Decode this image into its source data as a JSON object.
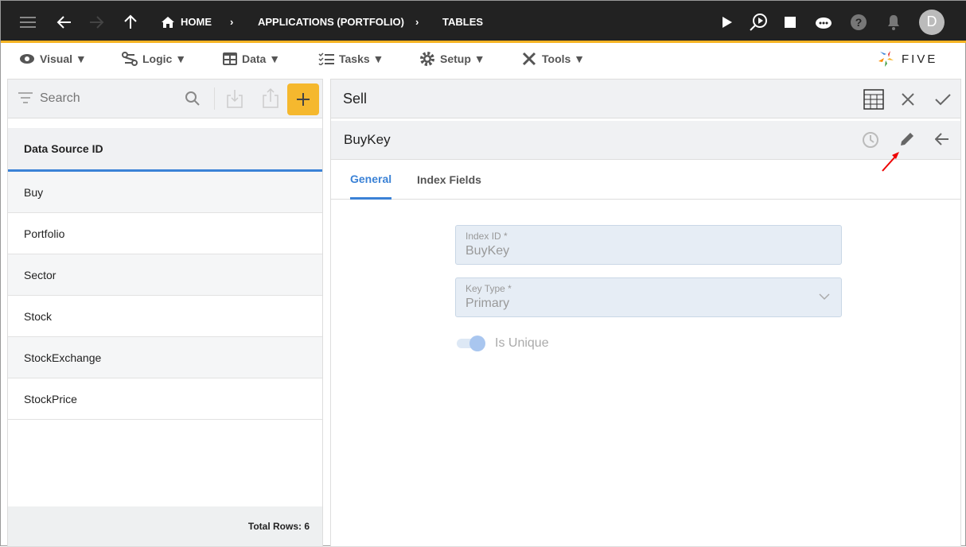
{
  "topbar": {
    "home": "HOME",
    "crumb1": "APPLICATIONS (PORTFOLIO)",
    "crumb2": "TABLES",
    "avatar": "D"
  },
  "menu": [
    "Visual ▼",
    "Logic ▼",
    "Data ▼",
    "Tasks ▼",
    "Setup ▼",
    "Tools ▼"
  ],
  "brand": "FIVE",
  "left": {
    "search_placeholder": "Search",
    "column": "Data Source ID",
    "rows": [
      "Buy",
      "Portfolio",
      "Sector",
      "Stock",
      "StockExchange",
      "StockPrice"
    ],
    "footer": "Total Rows: 6"
  },
  "right": {
    "title": "Sell",
    "subtitle": "BuyKey",
    "tabs": [
      "General",
      "Index Fields"
    ],
    "index_id_label": "Index ID *",
    "index_id": "BuyKey",
    "key_type_label": "Key Type *",
    "key_type": "Primary",
    "unique_label": "Is Unique",
    "unique": true
  },
  "colors": {
    "accent": "#f5b324",
    "tab": "#3b82d6"
  }
}
